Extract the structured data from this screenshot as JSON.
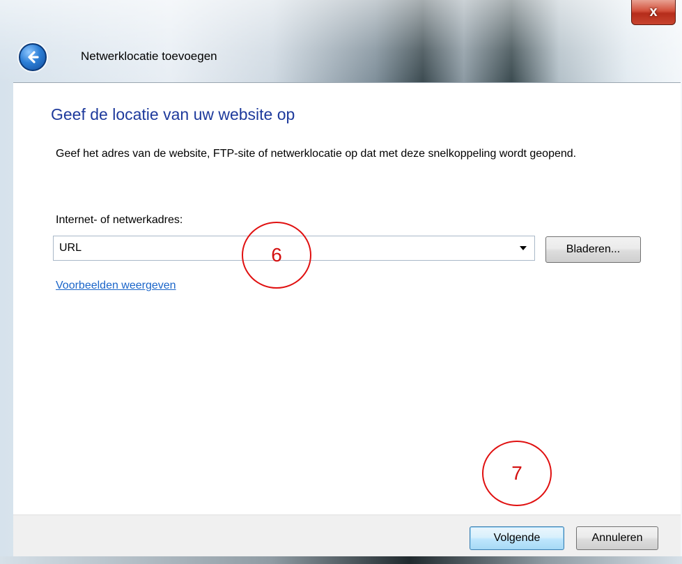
{
  "window": {
    "title": "Netwerklocatie toevoegen",
    "close_label": "x"
  },
  "page": {
    "heading": "Geef de locatie van uw website op",
    "description": "Geef het adres van de website, FTP-site of netwerklocatie op dat met deze snelkoppeling wordt geopend.",
    "field_label": "Internet- of netwerkadres:",
    "address_value": "URL",
    "browse_label": "Bladeren...",
    "examples_link": "Voorbeelden weergeven"
  },
  "footer": {
    "next_label": "Volgende",
    "cancel_label": "Annuleren"
  },
  "annotations": {
    "step6": "6",
    "step7": "7",
    "color": "#e01010"
  },
  "icons": {
    "back": "back-arrow-icon",
    "dropdown": "chevron-down-icon"
  }
}
